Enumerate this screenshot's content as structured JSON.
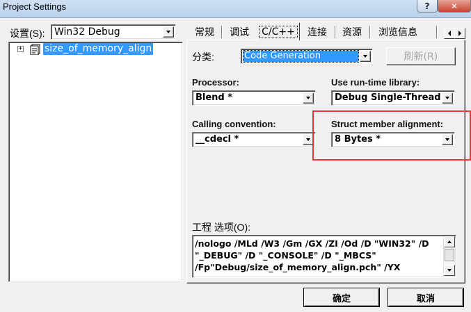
{
  "window": {
    "title": "Project Settings",
    "help_glyph": "?",
    "close_glyph": "✕"
  },
  "left": {
    "settings_label": "设置(S):",
    "settings_value": "Win32 Debug",
    "tree_expander": "+",
    "tree_item": "size_of_memory_align"
  },
  "tabs": [
    {
      "label": "常规"
    },
    {
      "label": "调试"
    },
    {
      "label": "C/C++"
    },
    {
      "label": "连接"
    },
    {
      "label": "资源"
    },
    {
      "label": "浏览信息"
    }
  ],
  "category": {
    "label": "分类:",
    "value": "Code Generation",
    "reset_label": "刷新(R)"
  },
  "processor": {
    "label": "Processor:",
    "value": "Blend *"
  },
  "runtime": {
    "label": "Use run-time library:",
    "value": "Debug Single-Threaded"
  },
  "calling": {
    "label": "Calling convention:",
    "value": "__cdecl *"
  },
  "struct_align": {
    "label": "Struct member alignment:",
    "value": "8 Bytes *"
  },
  "options": {
    "label": "工程 选项(O):",
    "lines": [
      "/nologo /MLd /W3 /Gm /GX /ZI /Od /D \"WIN32\" /D",
      "\"_DEBUG\" /D \"_CONSOLE\" /D \"_MBCS\"",
      "/Fp\"Debug/size_of_memory_align.pch\" /YX"
    ]
  },
  "buttons": {
    "ok": "确定",
    "cancel": "取消"
  },
  "colors": {
    "highlight_box": "#e8353a",
    "selection": "#3399ff",
    "close_button": "#c7452f"
  }
}
